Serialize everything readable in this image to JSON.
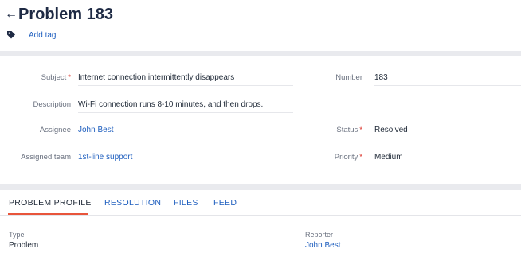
{
  "header": {
    "back_icon": "←",
    "title": "Problem 183",
    "add_tag": "Add tag"
  },
  "details": {
    "subject_label": "Subject",
    "subject_value": "Internet connection intermittently disappears",
    "number_label": "Number",
    "number_value": "183",
    "description_label": "Description",
    "description_value": "Wi-Fi connection runs 8-10 minutes, and then drops.",
    "assignee_label": "Assignee",
    "assignee_value": "John Best",
    "status_label": "Status",
    "status_value": "Resolved",
    "team_label": "Assigned team",
    "team_value": "1st-line support",
    "priority_label": "Priority",
    "priority_value": "Medium",
    "required_mark": "*"
  },
  "tabs": [
    {
      "label": "PROBLEM PROFILE",
      "active": true
    },
    {
      "label": "RESOLUTION",
      "active": false
    },
    {
      "label": "FILES",
      "active": false
    },
    {
      "label": "FEED",
      "active": false
    }
  ],
  "profile": {
    "type_label": "Type",
    "type_value": "Problem",
    "reporter_label": "Reporter",
    "reporter_value": "John Best"
  },
  "colors": {
    "title": "#1e2a44",
    "link": "#1f5fbf",
    "required": "#d9281e",
    "active_tab_underline": "#e8553b",
    "band": "#e9eaee"
  },
  "icons": {
    "back": "arrow-left-icon",
    "tag": "tag-icon"
  }
}
